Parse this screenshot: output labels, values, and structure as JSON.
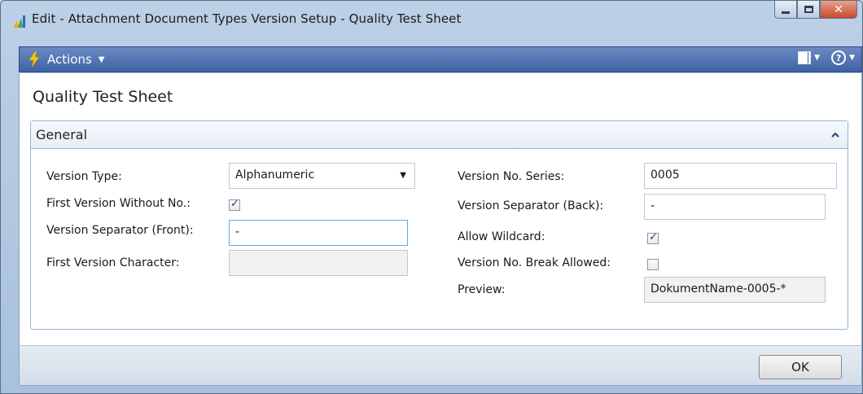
{
  "window": {
    "title": "Edit - Attachment Document Types Version Setup - Quality Test Sheet"
  },
  "actionbar": {
    "actions_label": "Actions",
    "icons": [
      "lightning-icon",
      "layout-icon",
      "help-icon"
    ]
  },
  "page": {
    "title": "Quality Test Sheet"
  },
  "general": {
    "title": "General",
    "version_type": {
      "label": "Version Type:",
      "value": "Alphanumeric"
    },
    "first_version_without_no": {
      "label": "First Version Without No.:",
      "checked": true
    },
    "version_separator_front": {
      "label": "Version Separator (Front):",
      "value": "-"
    },
    "first_version_character": {
      "label": "First Version Character:",
      "value": ""
    },
    "version_no_series": {
      "label": "Version No. Series:",
      "value": "0005"
    },
    "version_separator_back": {
      "label": "Version Separator (Back):",
      "value": "-"
    },
    "allow_wildcard": {
      "label": "Allow Wildcard:",
      "checked": true
    },
    "version_no_break_allowed": {
      "label": "Version No. Break Allowed:",
      "checked": false
    },
    "preview": {
      "label": "Preview:",
      "value": "DokumentName-0005-*"
    }
  },
  "footer": {
    "ok_label": "OK"
  },
  "colors": {
    "actionbar": "#3f62a6",
    "fasttab_border": "#8fb2d8",
    "close_button": "#c8482a"
  }
}
